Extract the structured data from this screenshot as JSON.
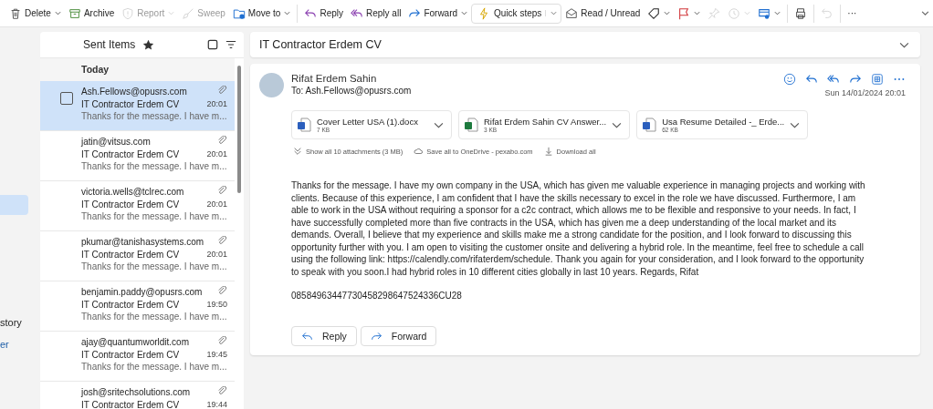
{
  "toolbar": {
    "items": [
      {
        "kind": "button",
        "label": "Delete",
        "dropdown": true,
        "disabled": false
      },
      {
        "kind": "button",
        "label": "Archive",
        "dropdown": false,
        "disabled": false
      },
      {
        "kind": "button",
        "label": "Report",
        "dropdown": true,
        "disabled": true
      },
      {
        "kind": "button",
        "label": "Sweep",
        "dropdown": false,
        "disabled": true
      },
      {
        "kind": "button",
        "label": "Move to",
        "dropdown": true,
        "disabled": false
      },
      {
        "kind": "separator"
      },
      {
        "kind": "button",
        "label": "Reply",
        "dropdown": false,
        "disabled": false
      },
      {
        "kind": "button",
        "label": "Reply all",
        "dropdown": false,
        "disabled": false
      },
      {
        "kind": "button",
        "label": "Forward",
        "dropdown": true,
        "disabled": false
      },
      {
        "kind": "split",
        "label": "Quick steps",
        "dropdown": true,
        "disabled": false
      },
      {
        "kind": "button",
        "label": "Read / Unread",
        "dropdown": false,
        "disabled": false
      },
      {
        "kind": "button",
        "dropdown": true,
        "disabled": false
      },
      {
        "kind": "button",
        "dropdown": true,
        "disabled": false
      },
      {
        "kind": "button",
        "dropdown": false,
        "disabled": true
      },
      {
        "kind": "button",
        "dropdown": true,
        "disabled": true
      },
      {
        "kind": "button",
        "dropdown": true,
        "disabled": false
      },
      {
        "kind": "separator"
      },
      {
        "kind": "button",
        "dropdown": false,
        "disabled": false
      },
      {
        "kind": "separator"
      },
      {
        "kind": "button",
        "dropdown": false,
        "disabled": true
      },
      {
        "kind": "separator"
      },
      {
        "kind": "button",
        "label": "···",
        "dropdown": false,
        "disabled": false
      }
    ]
  },
  "nav": {
    "items": [
      {
        "selected": true,
        "kind": "item"
      },
      {
        "label": "story",
        "selected": false,
        "kind": "item"
      },
      {
        "label": "er",
        "selected": false,
        "kind": "link"
      }
    ]
  },
  "message_list": {
    "title": "Sent Items",
    "favorite": true,
    "group": "Today",
    "messages": [
      {
        "from": "Ash.Fellows@opusrs.com",
        "subject": "IT Contractor Erdem CV",
        "time": "20:01",
        "preview": "Thanks for the message. I have m...",
        "attachment": true,
        "selected": true
      },
      {
        "from": "jatin@vitsus.com",
        "subject": "IT Contractor Erdem CV",
        "time": "20:01",
        "preview": "Thanks for the message. I have m...",
        "attachment": true,
        "selected": false
      },
      {
        "from": "victoria.wells@tclrec.com",
        "subject": "IT Contractor Erdem CV",
        "time": "20:01",
        "preview": "Thanks for the message. I have m...",
        "attachment": true,
        "selected": false
      },
      {
        "from": "pkumar@tanishasystems.com",
        "subject": "IT Contractor Erdem CV",
        "time": "20:01",
        "preview": "Thanks for the message. I have m...",
        "attachment": true,
        "selected": false
      },
      {
        "from": "benjamin.paddy@opusrs.com",
        "subject": "IT Contractor Erdem CV",
        "time": "19:50",
        "preview": "Thanks for the message. I have m...",
        "attachment": true,
        "selected": false
      },
      {
        "from": "ajay@quantumworldit.com",
        "subject": "IT Contractor Erdem CV",
        "time": "19:45",
        "preview": "Thanks for the message. I have m...",
        "attachment": true,
        "selected": false
      },
      {
        "from": "josh@sritechsolutions.com",
        "subject": "IT Contractor Erdem CV",
        "time": "19:44",
        "attachment": true,
        "selected": false
      }
    ]
  },
  "reading_pane": {
    "subject": "IT Contractor Erdem CV",
    "sender": "Rifat Erdem Sahin",
    "to_label": "To:",
    "to": "Ash.Fellows@opusrs.com",
    "date": "Sun 14/01/2024 20:01",
    "attachments": [
      {
        "name": "Cover Letter USA (1).docx",
        "size": "7 KB",
        "kind": "word"
      },
      {
        "name": "Rifat Erdem Sahin CV Answer...",
        "size": "3 KB",
        "kind": "excel"
      },
      {
        "name": "Usa Resume Detailed -_ Erde...",
        "size": "62 KB",
        "kind": "word"
      }
    ],
    "attachment_actions": [
      {
        "label": "Show all 10 attachments (3 MB)",
        "kind": "expand"
      },
      {
        "label": "Save all to OneDrive - pexabo.com",
        "kind": "cloud"
      },
      {
        "label": "Download all",
        "kind": "download"
      }
    ],
    "body": "Thanks for the message. I have my own company in the USA, which has given me valuable experience in managing projects and working with clients. Because of this experience, I am confident that I have the skills necessary to excel in the role we have discussed. Furthermore, I am able to work in the USA without requiring a sponsor for a c2c contract, which allows me to be flexible and responsive to your needs. In fact, I have successfully completed more than five contracts in the USA, which has given me a deep understanding of the local market and its demands. Overall, I believe that my experience and skills make me a strong candidate for the position, and I look forward to discussing this opportunity further with you. I am open to visiting the customer onsite and delivering a hybrid role. In the meantime, feel free to schedule a call using the following link: https://calendly.com/rifaterdem/schedule. Thank you again for your consideration, and I look forward to the opportunity to speak with you soon.I had hybrid roles in 10 different cities globally in last 10 years. Regards, Rifat",
    "signature": "08584963447730458298647524336CU28",
    "buttons": [
      {
        "label": "Reply",
        "kind": "reply"
      },
      {
        "label": "Forward",
        "kind": "forward"
      }
    ]
  }
}
